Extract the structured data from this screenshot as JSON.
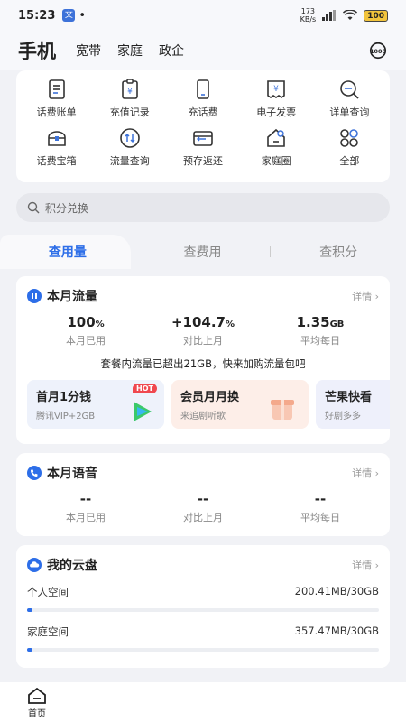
{
  "status_bar": {
    "time": "15:23",
    "app_chip": "文",
    "dot": "•",
    "net_speed_top": "173",
    "net_speed_bottom": "KB/s",
    "battery": "100"
  },
  "top_nav": {
    "current": "手机",
    "tabs": [
      "宽带",
      "家庭",
      "政企"
    ]
  },
  "quick_grid": [
    {
      "label": "话费账单",
      "icon": "bill-icon"
    },
    {
      "label": "充值记录",
      "icon": "recharge-record-icon"
    },
    {
      "label": "充话费",
      "icon": "phone-recharge-icon"
    },
    {
      "label": "电子发票",
      "icon": "invoice-icon"
    },
    {
      "label": "详单查询",
      "icon": "detail-query-icon"
    },
    {
      "label": "话费宝箱",
      "icon": "treasure-box-icon"
    },
    {
      "label": "流量查询",
      "icon": "data-query-icon"
    },
    {
      "label": "预存返还",
      "icon": "prepay-refund-icon"
    },
    {
      "label": "家庭圈",
      "icon": "family-circle-icon"
    },
    {
      "label": "全部",
      "icon": "all-services-icon"
    }
  ],
  "search": {
    "placeholder": "积分兑换"
  },
  "query_tabs": [
    "查用量",
    "查费用",
    "查积分"
  ],
  "data_section": {
    "title": "本月流量",
    "more": "详情 ›",
    "stats": [
      {
        "value": "100",
        "unit": "%",
        "label": "本月已用"
      },
      {
        "value": "+104.7",
        "unit": "%",
        "label": "对比上月"
      },
      {
        "value": "1.35",
        "unit": "GB",
        "label": "平均每日"
      }
    ],
    "notice": "套餐内流量已超出21GB，快来加购流量包吧",
    "promos": [
      {
        "title": "首月1分钱",
        "subtitle": "腾讯VIP+2GB",
        "badge": "HOT"
      },
      {
        "title": "会员月月换",
        "subtitle": "来追剧听歌"
      },
      {
        "title": "芒果快看",
        "subtitle": "好剧多多"
      }
    ]
  },
  "voice_section": {
    "title": "本月语音",
    "more": "详情 ›",
    "stats": [
      {
        "value": "--",
        "label": "本月已用"
      },
      {
        "value": "--",
        "label": "对比上月"
      },
      {
        "value": "--",
        "label": "平均每日"
      }
    ]
  },
  "cloud_section": {
    "title": "我的云盘",
    "more": "详情 ›",
    "rows": [
      {
        "label": "个人空间",
        "value": "200.41MB/30GB",
        "fraction": 0.0065
      },
      {
        "label": "家庭空间",
        "value": "357.47MB/30GB",
        "fraction": 0.0116
      }
    ]
  },
  "bottom_nav": {
    "home": "首页"
  },
  "colors": {
    "accent": "#2d6ee8",
    "hot": "#f0484f",
    "background": "#f1f2f6"
  }
}
